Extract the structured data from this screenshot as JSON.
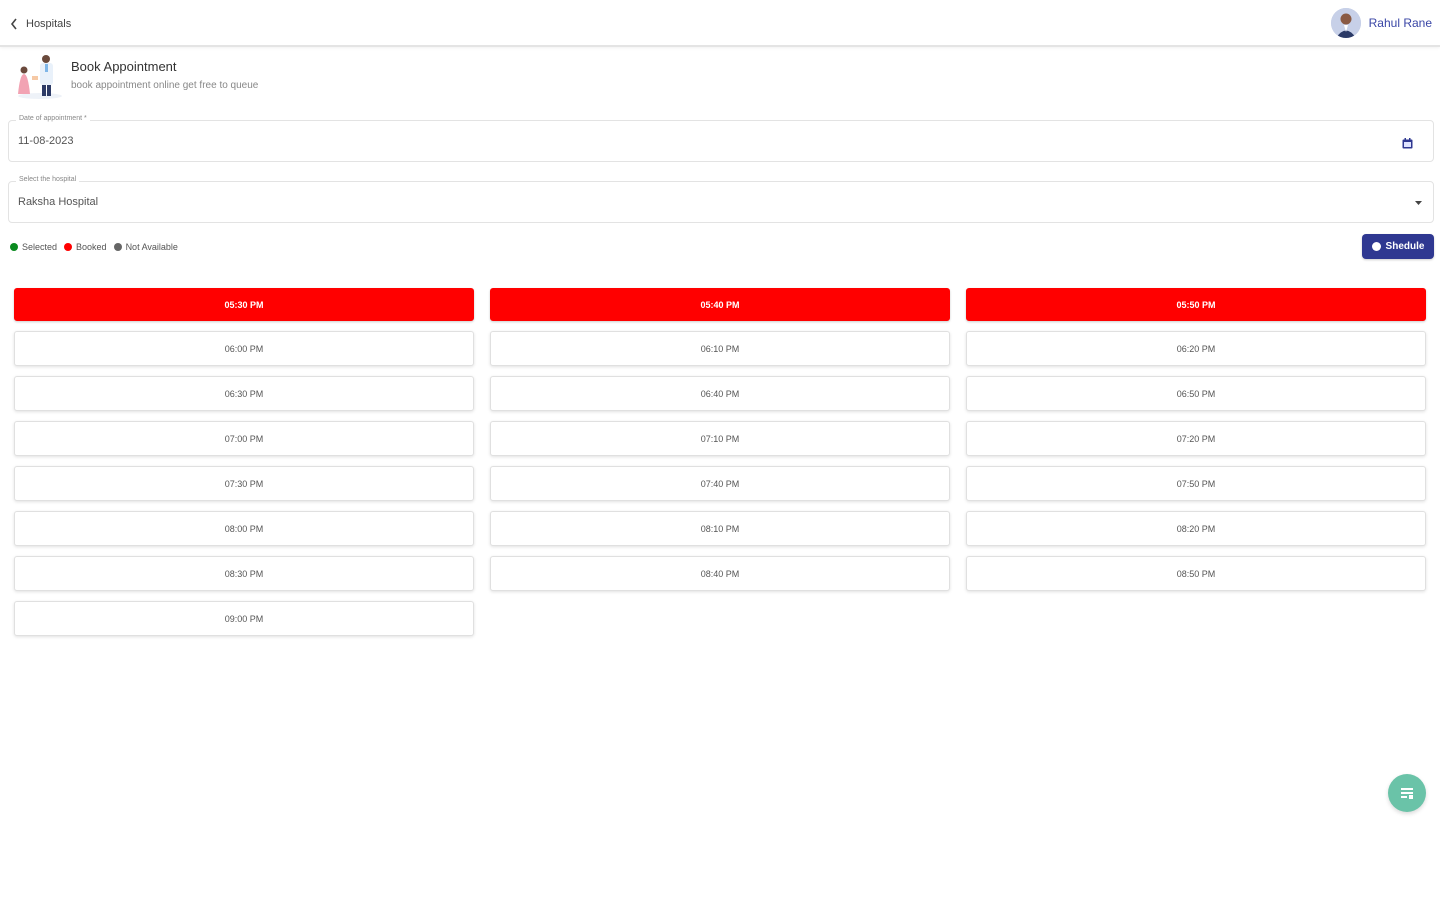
{
  "topbar": {
    "back_label": "Hospitals",
    "user_name": "Rahul Rane"
  },
  "header": {
    "title": "Book Appointment",
    "subtitle": "book appointment online get free to queue"
  },
  "date_field": {
    "label": "Date of appointment *",
    "value": "11-08-2023"
  },
  "hospital_field": {
    "label": "Select the hospital",
    "value": "Raksha Hospital"
  },
  "legend": [
    {
      "label": "Selected",
      "color": "#0a8a1f"
    },
    {
      "label": "Booked",
      "color": "#ff0000"
    },
    {
      "label": "Not Available",
      "color": "#666666"
    }
  ],
  "schedule_button": {
    "label": "Shedule"
  },
  "slots": [
    {
      "time": "05:30 PM",
      "status": "booked"
    },
    {
      "time": "05:40 PM",
      "status": "booked"
    },
    {
      "time": "05:50 PM",
      "status": "booked"
    },
    {
      "time": "06:00 PM",
      "status": "available"
    },
    {
      "time": "06:10 PM",
      "status": "available"
    },
    {
      "time": "06:20 PM",
      "status": "available"
    },
    {
      "time": "06:30 PM",
      "status": "available"
    },
    {
      "time": "06:40 PM",
      "status": "available"
    },
    {
      "time": "06:50 PM",
      "status": "available"
    },
    {
      "time": "07:00 PM",
      "status": "available"
    },
    {
      "time": "07:10 PM",
      "status": "available"
    },
    {
      "time": "07:20 PM",
      "status": "available"
    },
    {
      "time": "07:30 PM",
      "status": "available"
    },
    {
      "time": "07:40 PM",
      "status": "available"
    },
    {
      "time": "07:50 PM",
      "status": "available"
    },
    {
      "time": "08:00 PM",
      "status": "available"
    },
    {
      "time": "08:10 PM",
      "status": "available"
    },
    {
      "time": "08:20 PM",
      "status": "available"
    },
    {
      "time": "08:30 PM",
      "status": "available"
    },
    {
      "time": "08:40 PM",
      "status": "available"
    },
    {
      "time": "08:50 PM",
      "status": "available"
    },
    {
      "time": "09:00 PM",
      "status": "available"
    }
  ],
  "icons": {
    "back": "chevron-left-icon",
    "calendar": "calendar-icon",
    "dropdown": "caret-down-icon",
    "schedule": "circle-icon",
    "fab": "list-icon"
  },
  "colors": {
    "primary": "#2f3891",
    "booked": "#ff0000",
    "fab": "#6ac3a8"
  }
}
